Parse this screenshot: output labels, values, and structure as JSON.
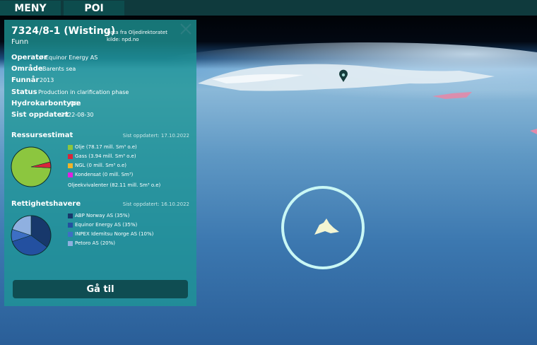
{
  "nav": {
    "menu_label": "MENY",
    "poi_label": "POI"
  },
  "panel": {
    "title": "7324/8-1 (Wisting)",
    "subtitle": "Funn",
    "source_line1": "Data fra Oljedirektoratet",
    "source_line2": "kilde: npd.no",
    "fields": [
      {
        "label": "Operatør",
        "value": "Equinor Energy AS"
      },
      {
        "label": "Område",
        "value": "Barents sea"
      },
      {
        "label": "Funnår",
        "value": "2013"
      },
      {
        "label": "Status",
        "value": "Production in clarification phase"
      },
      {
        "label": "Hydrokarbontype",
        "value": "OIL"
      },
      {
        "label": "Sist oppdatert",
        "value": "2022-08-30"
      }
    ],
    "resources": {
      "heading": "Ressursestimat",
      "updated": "Sist oppdatert: 17.10.2022",
      "items": [
        {
          "label": "Olje (78.17 mill. Sm³ o.e)",
          "value": 78.17,
          "color": "#8cc63f"
        },
        {
          "label": "Gass (3.94 mill. Sm³ o.e)",
          "value": 3.94,
          "color": "#d9263a"
        },
        {
          "label": "NGL (0 mill. Sm³ o.e)",
          "value": 0,
          "color": "#f0b429"
        },
        {
          "label": "Kondensat (0 mill. Sm³)",
          "value": 0,
          "color": "#e020e0"
        }
      ],
      "total": "Oljeekvivalenter (82.11 mill. Sm³ o.e)"
    },
    "licensees": {
      "heading": "Rettighetshavere",
      "updated": "Sist oppdatert: 16.10.2022",
      "items": [
        {
          "label": "ABP Norway AS (35%)",
          "value": 35,
          "color": "#17386b"
        },
        {
          "label": "Equinor Energy AS (35%)",
          "value": 35,
          "color": "#2350a0"
        },
        {
          "label": "INPEX Idemitsu Norge AS (10%)",
          "value": 10,
          "color": "#3d6fc4"
        },
        {
          "label": "Petoro AS (20%)",
          "value": 20,
          "color": "#8fb0e0"
        }
      ]
    },
    "goto_label": "Gå til"
  }
}
